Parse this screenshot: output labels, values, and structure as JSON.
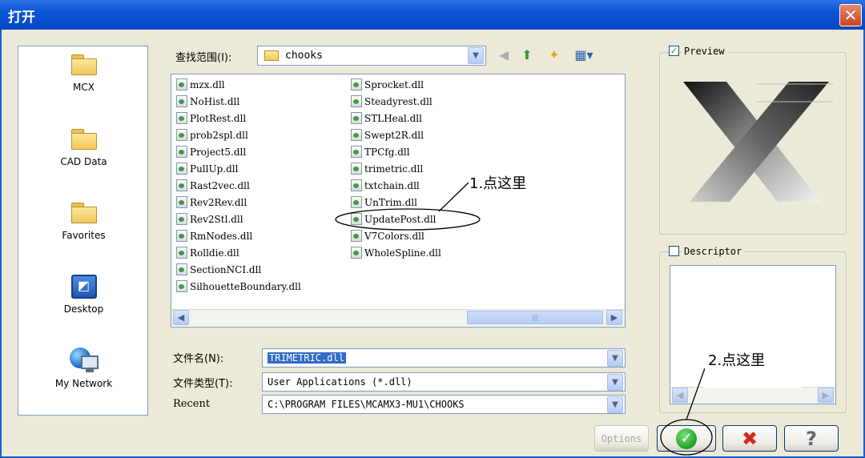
{
  "window": {
    "title": "打开"
  },
  "places": [
    {
      "label": "MCX",
      "icon": "folder-icon"
    },
    {
      "label": "CAD Data",
      "icon": "folder-icon"
    },
    {
      "label": "Favorites",
      "icon": "folder-icon"
    },
    {
      "label": "Desktop",
      "icon": "desktop-icon"
    },
    {
      "label": "My Network",
      "icon": "network-icon"
    }
  ],
  "look_in": {
    "label": "查找范围(I):",
    "value": "chooks"
  },
  "files_col1": [
    "mzx.dll",
    "NoHist.dll",
    "PlotRest.dll",
    "prob2spl.dll",
    "Project5.dll",
    "PullUp.dll",
    "Rast2vec.dll",
    "Rev2Rev.dll",
    "Rev2Stl.dll",
    "RmNodes.dll",
    "Rolldie.dll",
    "SectionNCI.dll",
    "SilhouetteBoundary.dll"
  ],
  "files_col2": [
    "Sprocket.dll",
    "Steadyrest.dll",
    "STLHeal.dll",
    "Swept2R.dll",
    "TPCfg.dll",
    "trimetric.dll",
    "txtchain.dll",
    "UnTrim.dll",
    "UpdatePost.dll",
    "V7Colors.dll",
    "WholeSpline.dll"
  ],
  "filename": {
    "label": "文件名(N):",
    "value": "TRIMETRIC.dll"
  },
  "filetype": {
    "label": "文件类型(T):",
    "value": "User Applications (*.dll)"
  },
  "recent": {
    "label": "Recent",
    "value": "C:\\PROGRAM FILES\\MCAMX3-MU1\\CHOOKS"
  },
  "preview": {
    "label": "Preview",
    "checked": true
  },
  "descriptor": {
    "label": "Descriptor",
    "checked": false
  },
  "buttons": {
    "options": "Options"
  },
  "annotations": {
    "step1": "1.点这里",
    "step2": "2.点这里"
  },
  "colors": {
    "accent": "#0a55d8",
    "selection": "#316ac5",
    "ok_green": "#21a121",
    "cancel_red": "#d8281e"
  }
}
